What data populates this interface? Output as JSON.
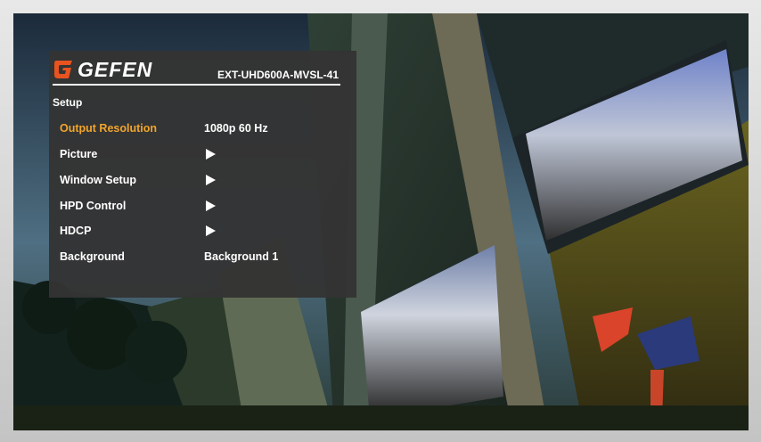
{
  "header": {
    "brand": "GEFEN",
    "model": "EXT-UHD600A-MVSL-41",
    "accent_color": "#f2a52b"
  },
  "menu": {
    "title": "Setup",
    "items": [
      {
        "label": "Output Resolution",
        "value": "1080p 60 Hz",
        "selected": true
      },
      {
        "label": "Picture",
        "value": "",
        "submenu": true
      },
      {
        "label": "Window Setup",
        "value": "",
        "submenu": true
      },
      {
        "label": "HPD Control",
        "value": "",
        "submenu": true
      },
      {
        "label": "HDCP",
        "value": "",
        "submenu": true
      },
      {
        "label": "Background",
        "value": "Background 1"
      }
    ]
  },
  "icons": {
    "logo": "gefen-logo-icon",
    "submenu": "play-arrow-icon"
  }
}
